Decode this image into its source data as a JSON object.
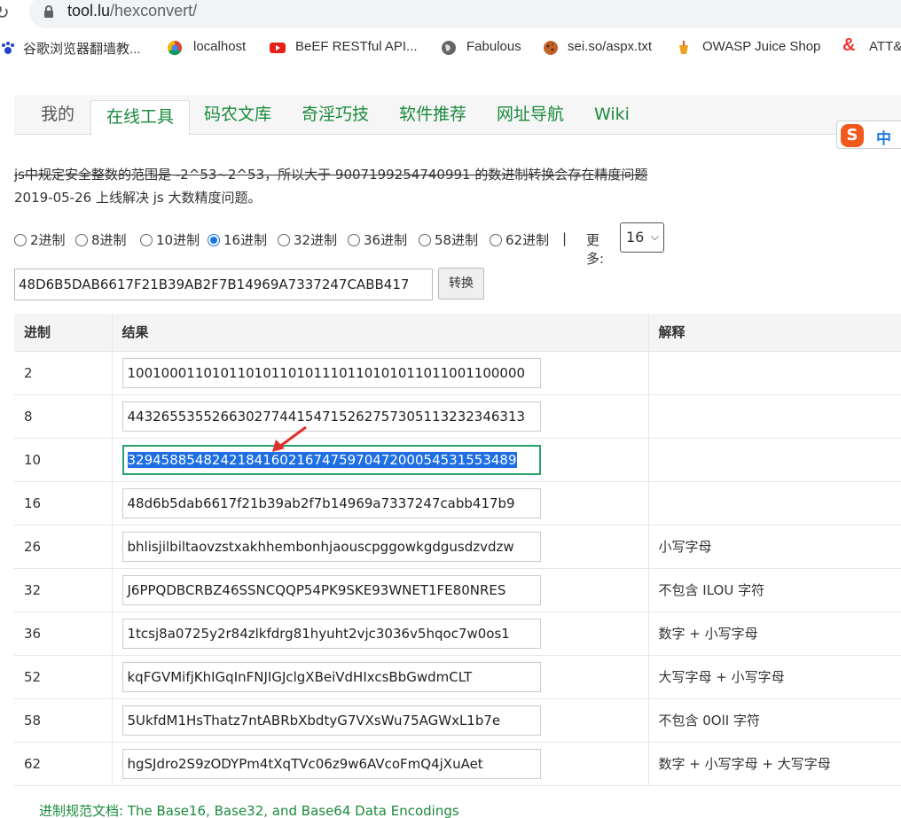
{
  "browser": {
    "url_host": "tool.lu",
    "url_path": "/hexconvert/"
  },
  "bookmarks": [
    {
      "label": "谷歌浏览器翻墙教...",
      "icon": "paw-icon",
      "color": "#2244cc"
    },
    {
      "label": "localhost",
      "icon": "chrome-like-icon",
      "color": "#e44"
    },
    {
      "label": "BeEF RESTful API...",
      "icon": "youtube-icon",
      "color": "#e62117"
    },
    {
      "label": "Fabulous",
      "icon": "globe-icon",
      "color": "#555555"
    },
    {
      "label": "sei.so/aspx.txt",
      "icon": "cookie-icon",
      "color": "#c0642a"
    },
    {
      "label": "OWASP Juice Shop",
      "icon": "juice-icon",
      "color": "#f0a020"
    },
    {
      "label": "ATT&",
      "icon": "ampersand-icon",
      "color": "#e33"
    }
  ],
  "nav": {
    "tabs": [
      "我的",
      "在线工具",
      "码农文库",
      "奇淫巧技",
      "软件推荐",
      "网址导航",
      "Wiki"
    ],
    "active": "在线工具"
  },
  "ime": {
    "s": "S",
    "zh": "中"
  },
  "notes": {
    "line1": "js中规定安全整数的范围是 -2^53~2^53，所以大于 9007199254740991 的数进制转换会存在精度问题",
    "line2": "2019-05-26 上线解决 js 大数精度问题。"
  },
  "radios": {
    "options": [
      "2进制",
      "8进制",
      "10进制",
      "16进制",
      "32进制",
      "36进制",
      "58进制",
      "62进制"
    ],
    "selected": "16进制",
    "sep": "|",
    "more_label": "更多:",
    "more_value": "16"
  },
  "input": {
    "value": "48D6B5DAB6617F21B39AB2F7B14969A7337247CABB417",
    "convert_label": "转换"
  },
  "table": {
    "headers": [
      "进制",
      "结果",
      "解释"
    ],
    "rows": [
      {
        "base": "2",
        "result": "10010001101011010110101110110101011011001100000",
        "desc": ""
      },
      {
        "base": "8",
        "result": "44326553552663027744154715262757305113232346313",
        "desc": ""
      },
      {
        "base": "10",
        "result": "3294588548242184160216747597047200054531553489",
        "desc": ""
      },
      {
        "base": "16",
        "result": "48d6b5dab6617f21b39ab2f7b14969a7337247cabb417b9",
        "desc": ""
      },
      {
        "base": "26",
        "result": "bhlisjilbiltaovzstxakhhembonhjaouscpggowkgdgusdzvdzw",
        "desc": "小写字母"
      },
      {
        "base": "32",
        "result": "J6PPQDBCRBZ46SSNCQQP54PK9SKE93WNET1FE80NRES",
        "desc": "不包含 ILOU 字符"
      },
      {
        "base": "36",
        "result": "1tcsj8a0725y2r84zlkfdrg81hyuht2vjc3036v5hqoc7w0os1",
        "desc": "数字 + 小写字母"
      },
      {
        "base": "52",
        "result": "kqFGVMifjKhIGqInFNJIGJclgXBeiVdHIxcsBbGwdmCLT",
        "desc": "大写字母 + 小写字母"
      },
      {
        "base": "58",
        "result": "5UkfdM1HsThatz7ntABRbXbdtyG7VXsWu75AGWxL1b7e",
        "desc": "不包含 0OlI 字符"
      },
      {
        "base": "62",
        "result": "hgSJdro2S9zODYPm4tXqTVc06z9w6AVcoFmQ4jXuAet",
        "desc": "数字 + 小写字母 + 大写字母"
      }
    ]
  },
  "footer": "进制规范文档: The Base16, Base32, and Base64 Data Encodings"
}
